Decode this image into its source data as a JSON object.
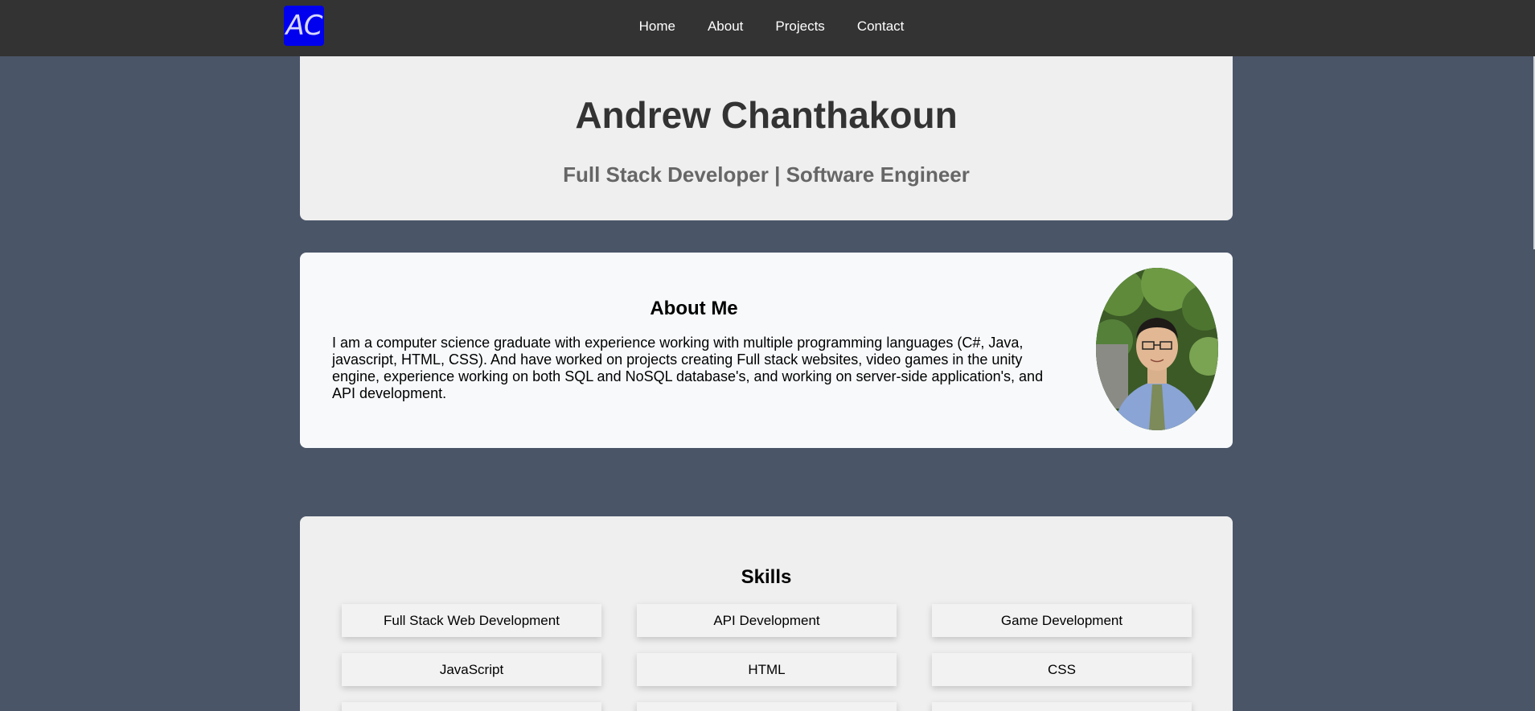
{
  "navbar": {
    "logo_text": "AC",
    "links": [
      "Home",
      "About",
      "Projects",
      "Contact"
    ]
  },
  "hero": {
    "name": "Andrew Chanthakoun",
    "tagline": "Full Stack Developer | Software Engineer"
  },
  "about": {
    "heading": "About Me",
    "body": "I am a computer science graduate with experience working with multiple programming languages (C#, Java, javascript, HTML, CSS). And have worked on projects creating Full stack websites, video games in the unity engine, experience working on both SQL and NoSQL database's, and working on server-side application's, and API development."
  },
  "skills": {
    "heading": "Skills",
    "items": [
      "Full Stack Web Development",
      "API Development",
      "Game Development",
      "JavaScript",
      "HTML",
      "CSS"
    ]
  },
  "colors": {
    "background": "#4a5568",
    "navbar": "#333333",
    "logo": "#0000ee",
    "card": "#efefef"
  }
}
